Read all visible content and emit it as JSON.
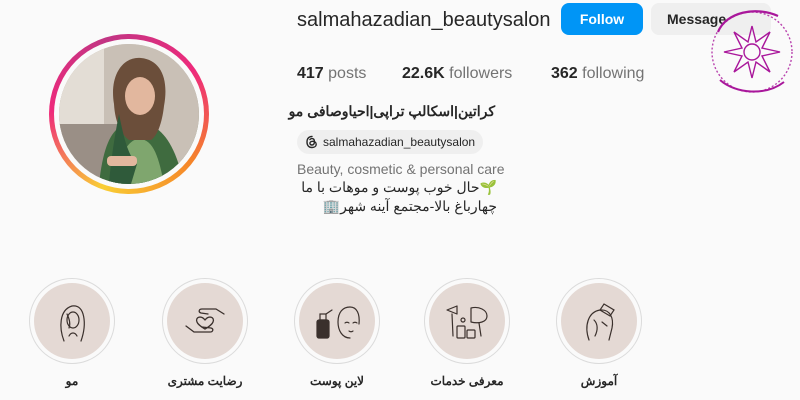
{
  "profile": {
    "username": "salmahazadian_beautysalon",
    "follow_label": "Follow",
    "message_label": "Message",
    "stats": {
      "posts_count": "417",
      "posts_label": "posts",
      "followers_count": "22.6K",
      "followers_label": "followers",
      "following_count": "362",
      "following_label": "following"
    },
    "full_name": "کراتین|اسکالپ تراپی|احیاوصافی مو",
    "threads_handle": "salmahazadian_beautysalon",
    "category": "Beauty, cosmetic & personal care",
    "bio_lines": [
      "🌱حال خوب پوست و موهات با ما",
      "چهارباغ بالا-مجتمع آینه شهر🏢"
    ]
  },
  "highlights": [
    {
      "label": "مو",
      "icon": "woman-hair-icon"
    },
    {
      "label": "رضایت مشتری",
      "icon": "hands-heart-icon"
    },
    {
      "label": "لاین پوست",
      "icon": "skincare-face-icon"
    },
    {
      "label": "معرفی خدمات",
      "icon": "salon-tools-icon"
    },
    {
      "label": "آموزش",
      "icon": "hair-treatment-icon"
    }
  ],
  "colors": {
    "follow_button": "#0095f6",
    "highlight_background": "#e4d9d4",
    "watermark": "#a9179b"
  }
}
